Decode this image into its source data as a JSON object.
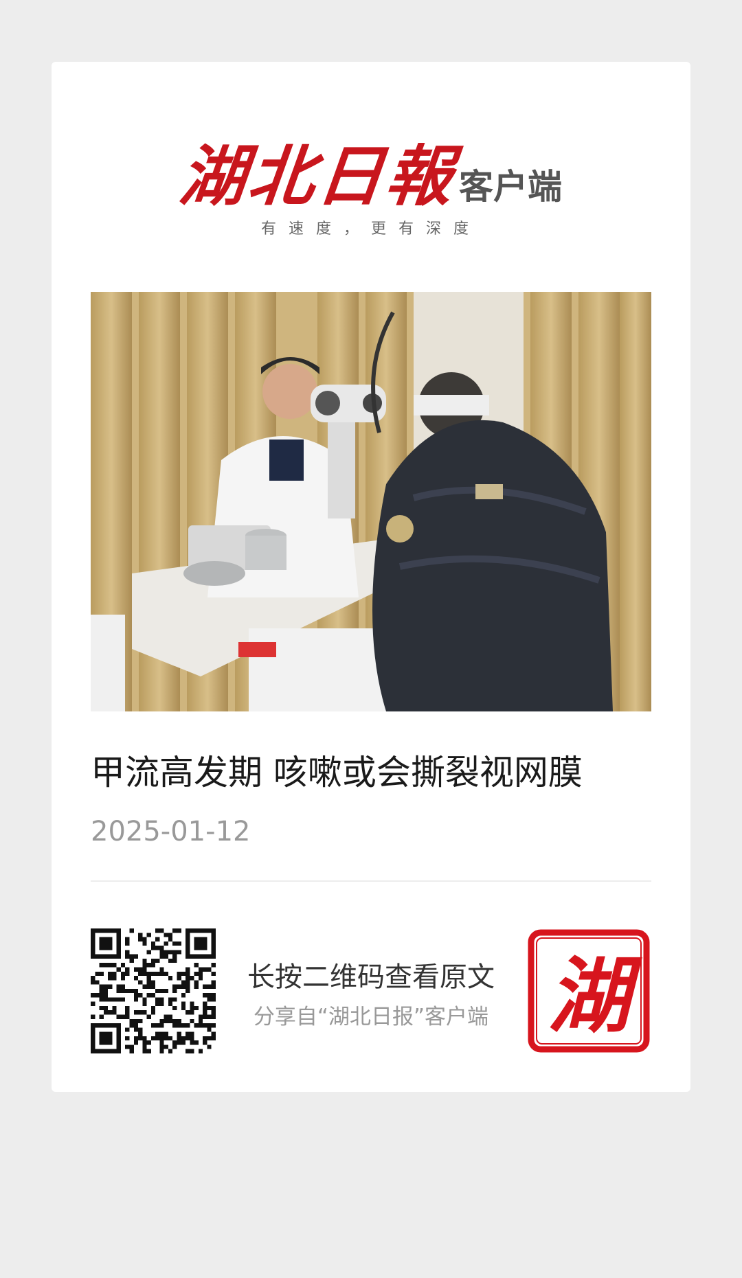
{
  "header": {
    "logo_main": "湖北日報",
    "logo_sub": "客户端",
    "slogan": "有速度，更有深度"
  },
  "article": {
    "image_alt": "眼科医生使用裂隙灯为患者检查视网膜",
    "title": "甲流高发期 咳嗽或会撕裂视网膜",
    "date": "2025-01-12"
  },
  "share": {
    "main": "长按二维码查看原文",
    "sub": "分享自“湖北日报”客户端",
    "seal_char": "湖"
  },
  "colors": {
    "brand_red": "#c8161d",
    "background": "#ededed",
    "card": "#ffffff"
  }
}
